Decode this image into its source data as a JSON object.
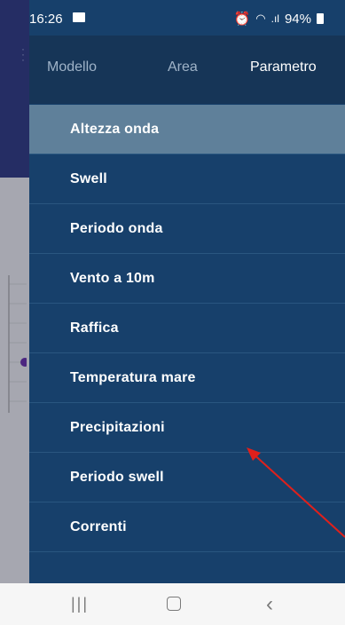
{
  "status_bar": {
    "time": "16:26",
    "battery": "94%",
    "icons": [
      "gallery-icon",
      "alarm-icon",
      "wifi-icon",
      "signal-icon",
      "battery-icon"
    ]
  },
  "drawer": {
    "tabs": [
      {
        "label": "Modello",
        "active": false
      },
      {
        "label": "Area",
        "active": false
      },
      {
        "label": "Parametro",
        "active": true
      }
    ],
    "items": [
      {
        "label": "Altezza onda",
        "selected": true
      },
      {
        "label": "Swell",
        "selected": false
      },
      {
        "label": "Periodo onda",
        "selected": false
      },
      {
        "label": "Vento a 10m",
        "selected": false
      },
      {
        "label": "Raffica",
        "selected": false
      },
      {
        "label": "Temperatura mare",
        "selected": false
      },
      {
        "label": "Precipitazioni",
        "selected": false
      },
      {
        "label": "Periodo swell",
        "selected": false
      },
      {
        "label": "Correnti",
        "selected": false
      }
    ]
  },
  "annotation": {
    "color": "#e0201b",
    "icon": "arrow-annotation"
  },
  "colors": {
    "drawer_bg": "#17406b",
    "tabs_bg": "#163557",
    "selected_bg": "#5f809a",
    "app_header": "#2e3a85"
  },
  "nav_bar": {
    "buttons": [
      "recent-apps-icon",
      "home-icon",
      "back-icon"
    ]
  }
}
